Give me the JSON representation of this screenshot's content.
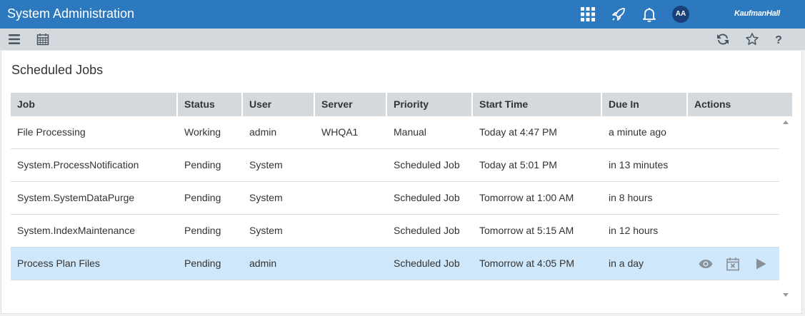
{
  "header": {
    "title": "System Administration",
    "avatar_initials": "AA",
    "brand": "KaufmanHall",
    "icons": [
      "apps-grid-icon",
      "rocket-icon",
      "bell-icon"
    ]
  },
  "toolbar": {
    "left_icons": [
      "menu-icon",
      "calendar-icon"
    ],
    "right_icons": [
      "refresh-icon",
      "star-icon",
      "help-icon"
    ]
  },
  "page": {
    "title": "Scheduled Jobs"
  },
  "table": {
    "columns": [
      "Job",
      "Status",
      "User",
      "Server",
      "Priority",
      "Start Time",
      "Due In",
      "Actions"
    ],
    "rows": [
      [
        "File Processing",
        "Working",
        "admin",
        "WHQA1",
        "Manual",
        "Today at 4:47 PM",
        "a minute ago"
      ],
      [
        "System.ProcessNotification",
        "Pending",
        "System",
        "",
        "Scheduled Job",
        "Today at 5:01 PM",
        "in 13 minutes"
      ],
      [
        "System.SystemDataPurge",
        "Pending",
        "System",
        "",
        "Scheduled Job",
        "Tomorrow at 1:00 AM",
        "in 8 hours"
      ],
      [
        "System.IndexMaintenance",
        "Pending",
        "System",
        "",
        "Scheduled Job",
        "Tomorrow at 5:15 AM",
        "in 12 hours"
      ],
      [
        "Process Plan Files",
        "Pending",
        "admin",
        "",
        "Scheduled Job",
        "Tomorrow at 4:05 PM",
        "in a day"
      ]
    ],
    "selected_row": 4,
    "action_icons": [
      "eye-icon",
      "calendar-cancel-icon",
      "play-icon"
    ]
  },
  "colors": {
    "header_bg": "#2c79bf",
    "toolbar_bg": "#d4d9de",
    "selected_row_bg": "#cfe7fa",
    "avatar_bg": "#1b3f78"
  }
}
